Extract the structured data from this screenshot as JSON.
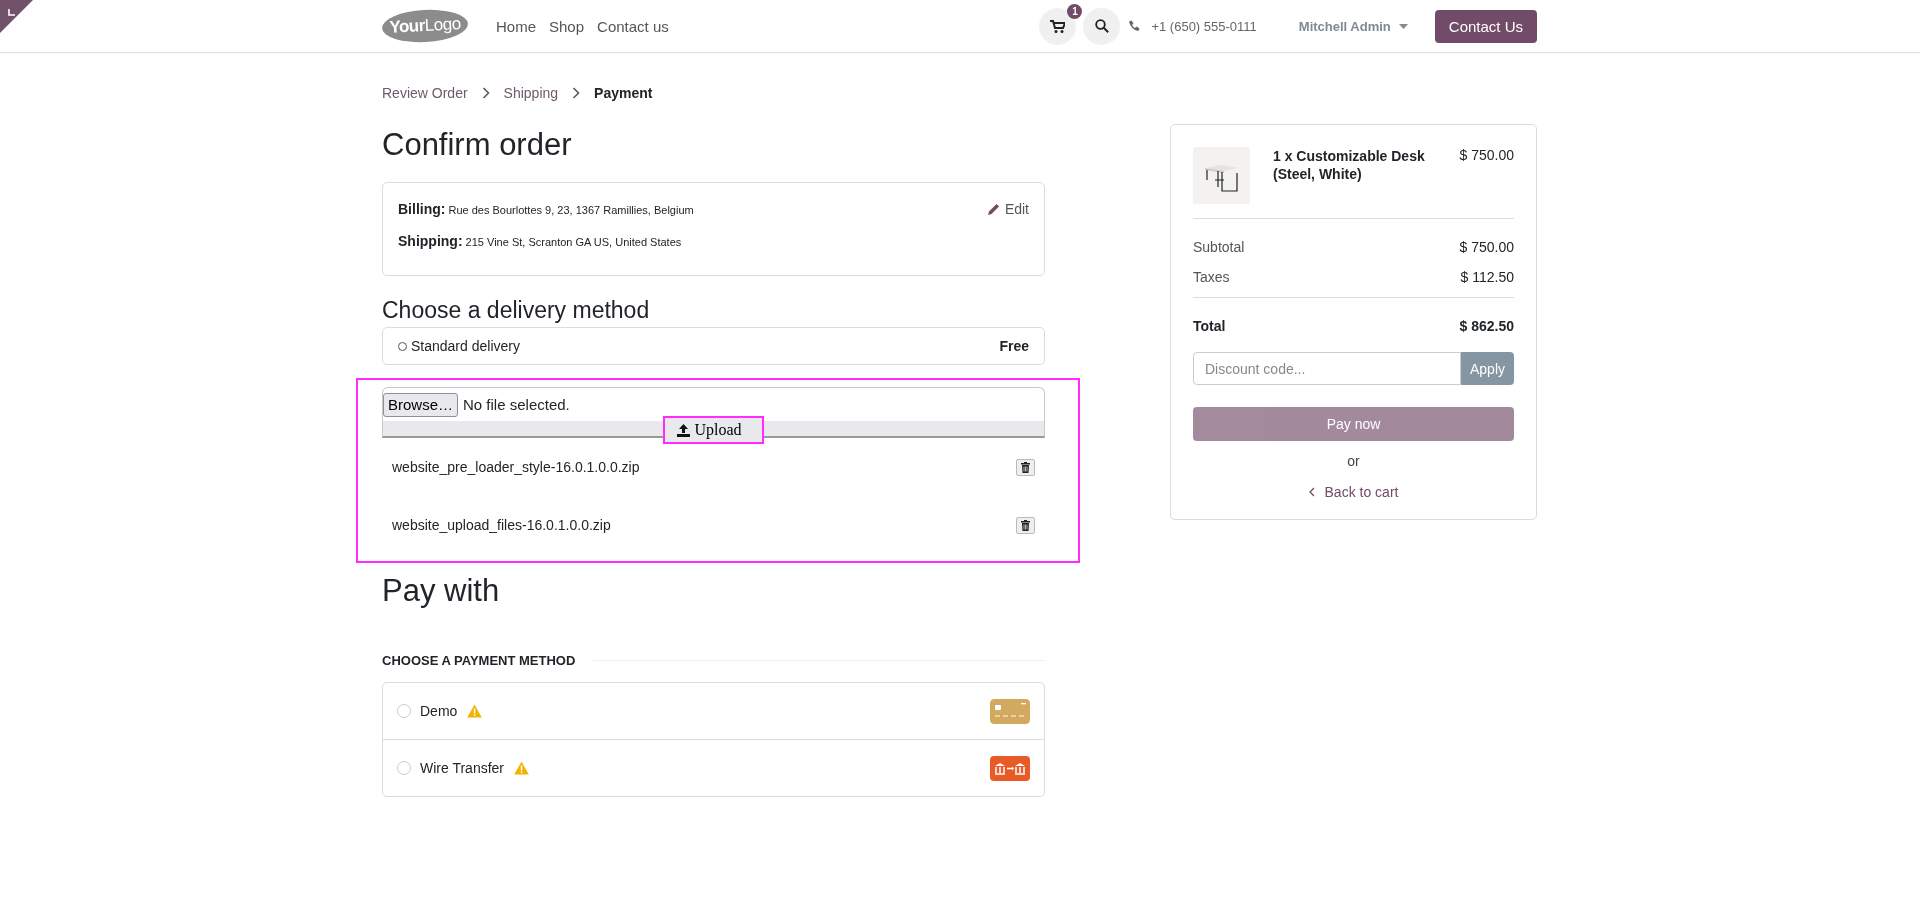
{
  "header": {
    "logo": "**Your**Logo",
    "nav": [
      {
        "label": "Home"
      },
      {
        "label": "Shop"
      },
      {
        "label": "Contact us"
      }
    ],
    "cart_count": "1",
    "phone": "+1 (650) 555-0111",
    "user": "Mitchell Admin",
    "cta": "Contact Us"
  },
  "breadcrumb": [
    {
      "label": "Review Order",
      "selected": false
    },
    {
      "label": "Shipping",
      "selected": false
    },
    {
      "label": "Payment",
      "selected": true
    }
  ],
  "title": "Confirm order",
  "addresses": {
    "edit": "Edit",
    "rows": [
      {
        "label": "Billing:",
        "value": "Rue des Bourlottes 9, 23, 1367 Ramillies, Belgium"
      },
      {
        "label": "Shipping:",
        "value": "215 Vine St, Scranton GA US, United States"
      }
    ]
  },
  "delivery": {
    "heading": "Choose a delivery method",
    "methods": [
      {
        "name": "Standard delivery",
        "price": "Free",
        "selected": false
      }
    ]
  },
  "upload": {
    "browse": "Browse…",
    "status": "No file selected.",
    "button": "Upload",
    "files": [
      {
        "name": "website_pre_loader_style-16.0.1.0.0.zip"
      },
      {
        "name": "website_upload_files-16.0.1.0.0.zip"
      }
    ]
  },
  "payment": {
    "heading": "Pay with",
    "subheading": "CHOOSE A PAYMENT METHOD",
    "methods": [
      {
        "name": "Demo",
        "selected": false,
        "warning": true,
        "kind": "card"
      },
      {
        "name": "Wire Transfer",
        "selected": false,
        "warning": true,
        "kind": "bank"
      }
    ]
  },
  "summary": {
    "product": {
      "name": "1 x Customizable Desk (Steel, White)",
      "price": "$ 750.00"
    },
    "lines": [
      {
        "label": "Subtotal",
        "value": "$ 750.00"
      },
      {
        "label": "Taxes",
        "value": "$ 112.50"
      }
    ],
    "total": {
      "label": "Total",
      "value": "$ 862.50"
    },
    "discount_placeholder": "Discount code...",
    "apply": "Apply",
    "pay": {
      "label": "Pay now",
      "disabled": true
    },
    "or": "or",
    "back": "Back to cart"
  }
}
